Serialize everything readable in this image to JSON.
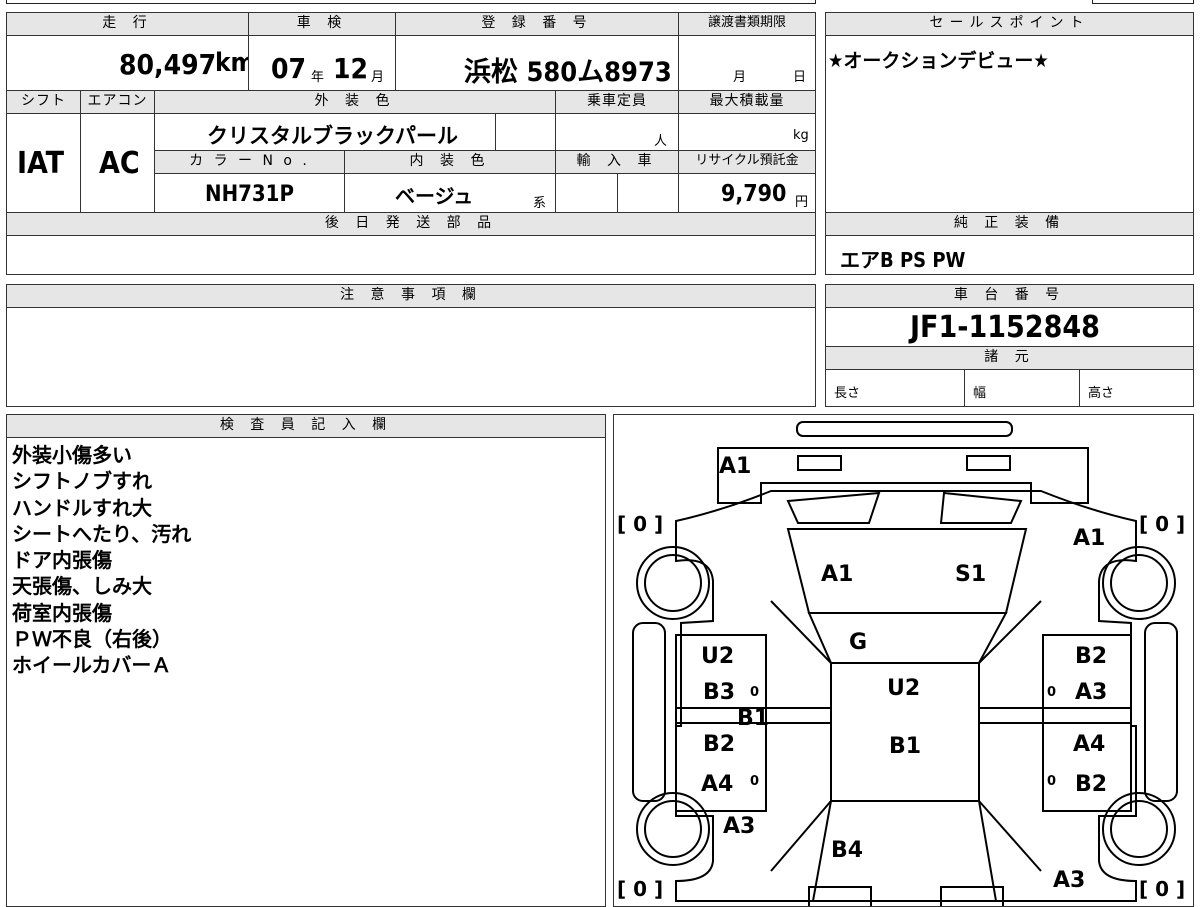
{
  "headers": {
    "mileage": "走 行",
    "inspection": "車 検",
    "registration": "登 録 番 号",
    "transfer_docs": "譲渡書類期限",
    "sales_point": "セールスポイント",
    "shift": "シフト",
    "aircon": "エアコン",
    "exterior_color": "外 装 色",
    "capacity": "乗車定員",
    "max_load": "最大積載量",
    "color_no": "カ ラ ー N o .",
    "interior_color": "内 装 色",
    "import": "輸 入 車",
    "recycle": "リサイクル預託金",
    "later_parts": "後 日 発 送 部 品",
    "genuine_equipment": "純 正 装 備",
    "notes": "注 意 事 項 欄",
    "chassis": "車 台 番 号",
    "specs": "諸 元",
    "inspector": "検 査 員 記 入 欄"
  },
  "values": {
    "mileage": "80,497",
    "mileage_unit": "km",
    "inspection_year": "07",
    "year_unit": "年",
    "inspection_month": "12",
    "month_unit": "月",
    "registration": "浜松 580ム8973",
    "transfer_month": "月",
    "transfer_day": "日",
    "sales_point": "★オークションデビュー★",
    "shift": "IAT",
    "aircon": "AC",
    "exterior_color": "クリスタルブラックパール",
    "capacity_unit": "人",
    "load_unit": "kg",
    "color_no": "NH731P",
    "interior_color": "ベージュ",
    "interior_suffix": "系",
    "recycle_fee": "9,790",
    "yen": "円",
    "genuine_equipment": "エアB PS PW",
    "chassis": "JF1-1152848",
    "length": "長さ",
    "width": "幅",
    "height": "高さ"
  },
  "inspector_notes": [
    "外装小傷多い",
    "シフトノブすれ",
    "ハンドルすれ大",
    "シートへたり、汚れ",
    "ドア内張傷",
    "天張傷、しみ大",
    "荷室内張傷",
    "ＰＷ不良（右後）",
    "ホイールカバーＡ"
  ],
  "diagram": {
    "tire_brackets": "[ 0 ]",
    "marks": [
      "A1",
      "A1",
      "A1",
      "S1",
      "G",
      "U2",
      "U2",
      "B3",
      "B1",
      "B2",
      "A4",
      "B1",
      "B2",
      "A3",
      "A4",
      "B2",
      "A3",
      "B4",
      "A3"
    ],
    "zeros": [
      "0",
      "0",
      "0",
      "0"
    ]
  }
}
